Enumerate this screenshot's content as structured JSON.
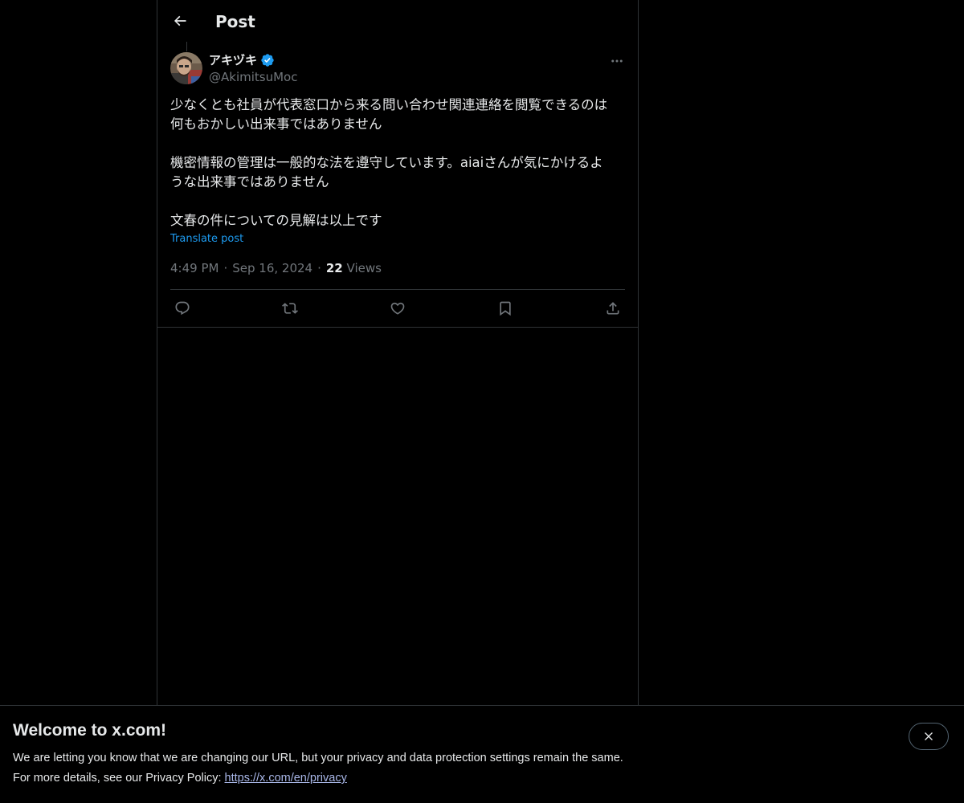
{
  "header": {
    "title": "Post"
  },
  "post": {
    "author": {
      "display_name": "アキヅキ",
      "handle": "@AkimitsuMoc",
      "verified": true
    },
    "text": "少なくとも社員が代表窓口から来る問い合わせ関連連絡を閲覧できるのは\n何もおかしい出来事ではありません\n\n機密情報の管理は一般的な法を遵守しています。aiaiさんが気にかけるよ\nうな出来事ではありません\n\n文春の件についての見解は以上です",
    "translate_label": "Translate post",
    "time": "4:49 PM",
    "date": "Sep 16, 2024",
    "views_count": "22",
    "views_label": "Views",
    "separator": "·"
  },
  "actions": [
    {
      "name": "reply-icon"
    },
    {
      "name": "repost-icon"
    },
    {
      "name": "like-icon"
    },
    {
      "name": "bookmark-icon"
    },
    {
      "name": "share-icon"
    }
  ],
  "banner": {
    "title": "Welcome to x.com!",
    "line1": "We are letting you know that we are changing our URL, but your privacy and data protection settings remain the same.",
    "line2_prefix": "For more details, see our Privacy Policy: ",
    "link_text": "https://x.com/en/privacy"
  },
  "colors": {
    "background": "#000000",
    "text": "#e7e9ea",
    "secondary": "#71767b",
    "accent": "#1d9bf0",
    "border": "#2f3336",
    "verified": "#1d9bf0"
  }
}
